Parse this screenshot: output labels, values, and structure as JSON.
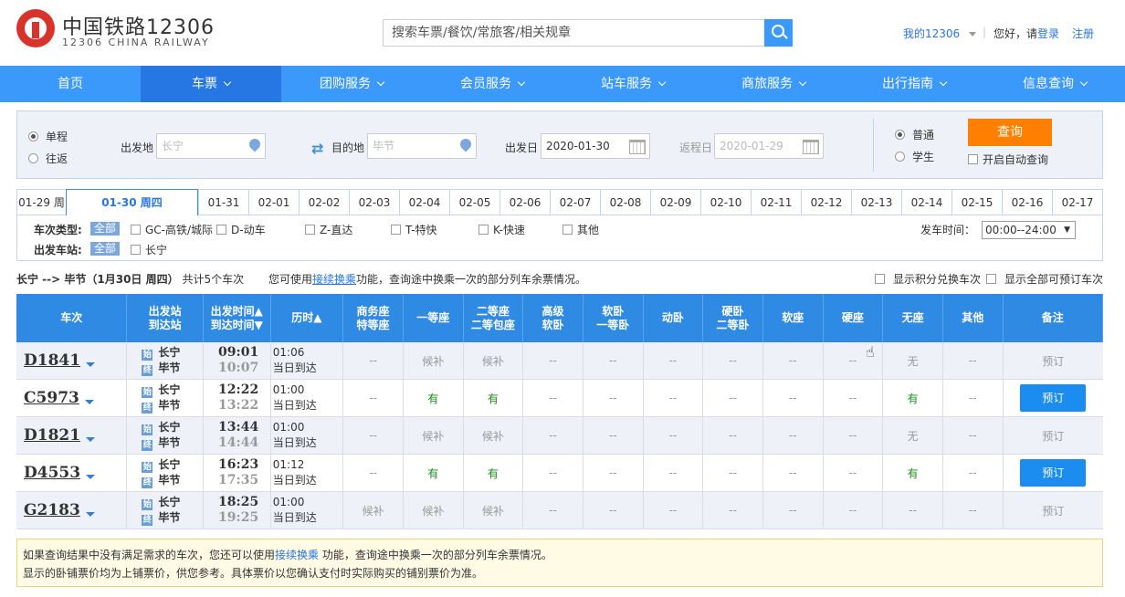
{
  "header": {
    "logo_title": "中国铁路12306",
    "logo_sub": "12306 CHINA RAILWAY",
    "search_placeholder": "搜索车票/餐饮/常旅客/相关规章",
    "my12306": "我的12306",
    "greet": "您好，请",
    "login": "登录",
    "register": "注册"
  },
  "nav": [
    {
      "label": "首页"
    },
    {
      "label": "车票"
    },
    {
      "label": "团购服务"
    },
    {
      "label": "会员服务"
    },
    {
      "label": "站车服务"
    },
    {
      "label": "商旅服务"
    },
    {
      "label": "出行指南"
    },
    {
      "label": "信息查询"
    }
  ],
  "query": {
    "oneway": "单程",
    "roundtrip": "往返",
    "from_label": "出发地",
    "from_value": "长宁",
    "to_label": "目的地",
    "to_value": "毕节",
    "date_label": "出发日",
    "date_value": "2020-01-30",
    "return_label": "返程日",
    "return_value": "2020-01-29",
    "normal": "普通",
    "student": "学生",
    "query_btn": "查询",
    "auto_query": "开启自动查询"
  },
  "dates": [
    "01-29 周",
    "01-30 周四",
    "01-31",
    "02-01",
    "02-02",
    "02-03",
    "02-04",
    "02-05",
    "02-06",
    "02-07",
    "02-08",
    "02-09",
    "02-10",
    "02-11",
    "02-12",
    "02-13",
    "02-14",
    "02-15",
    "02-16",
    "02-17"
  ],
  "filters": {
    "type_label": "车次类型:",
    "all": "全部",
    "types": [
      "GC-高铁/城际",
      "D-动车",
      "Z-直达",
      "T-特快",
      "K-快速",
      "其他"
    ],
    "station_label": "出发车站:",
    "station": "长宁",
    "time_label": "发车时间：",
    "time_value": "00:00--24:00"
  },
  "summary": {
    "route": "长宁 --> 毕节（1月30日 周四）",
    "count": "共计5个车次",
    "tip_pre": "您可使用",
    "tip_link": "接续换乘",
    "tip_post": "功能，查询途中换乘一次的部分列车余票情况。",
    "opt1": "显示积分兑换车次",
    "opt2": "显示全部可预订车次"
  },
  "table_headers": [
    [
      "车次",
      ""
    ],
    [
      "出发站",
      "到达站"
    ],
    [
      "出发时间▲",
      "到达时间▼"
    ],
    [
      "历时▲",
      ""
    ],
    [
      "商务座",
      "特等座"
    ],
    [
      "一等座",
      ""
    ],
    [
      "二等座",
      "二等包座"
    ],
    [
      "高级",
      "软卧"
    ],
    [
      "软卧",
      "一等卧"
    ],
    [
      "动卧",
      ""
    ],
    [
      "硬卧",
      "二等卧"
    ],
    [
      "软座",
      ""
    ],
    [
      "硬座",
      ""
    ],
    [
      "无座",
      ""
    ],
    [
      "其他",
      ""
    ],
    [
      "备注",
      ""
    ]
  ],
  "trains": [
    {
      "no": "D1841",
      "from": "长宁",
      "to": "毕节",
      "dep": "09:01",
      "arr": "10:07",
      "dur": "01:06",
      "arrday": "当日到达",
      "seats": [
        "--",
        "候补",
        "候补",
        "--",
        "--",
        "--",
        "--",
        "--",
        "--",
        "无",
        "--"
      ],
      "action": "预订",
      "bookable": false
    },
    {
      "no": "C5973",
      "from": "长宁",
      "to": "毕节",
      "dep": "12:22",
      "arr": "13:22",
      "dur": "01:00",
      "arrday": "当日到达",
      "seats": [
        "--",
        "有",
        "有",
        "--",
        "--",
        "--",
        "--",
        "--",
        "--",
        "有",
        "--"
      ],
      "action": "预订",
      "bookable": true
    },
    {
      "no": "D1821",
      "from": "长宁",
      "to": "毕节",
      "dep": "13:44",
      "arr": "14:44",
      "dur": "01:00",
      "arrday": "当日到达",
      "seats": [
        "--",
        "候补",
        "候补",
        "--",
        "--",
        "--",
        "--",
        "--",
        "--",
        "无",
        "--"
      ],
      "action": "预订",
      "bookable": false
    },
    {
      "no": "D4553",
      "from": "长宁",
      "to": "毕节",
      "dep": "16:23",
      "arr": "17:35",
      "dur": "01:12",
      "arrday": "当日到达",
      "seats": [
        "--",
        "有",
        "有",
        "--",
        "--",
        "--",
        "--",
        "--",
        "--",
        "有",
        "--"
      ],
      "action": "预订",
      "bookable": true
    },
    {
      "no": "G2183",
      "from": "长宁",
      "to": "毕节",
      "dep": "18:25",
      "arr": "19:25",
      "dur": "01:00",
      "arrday": "当日到达",
      "seats": [
        "候补",
        "候补",
        "候补",
        "--",
        "--",
        "--",
        "--",
        "--",
        "--",
        "--",
        "--"
      ],
      "action": "预订",
      "bookable": false
    }
  ],
  "note": {
    "l1_pre": "如果查询结果中没有满足需求的车次，您还可以使用",
    "l1_link": "接续换乘",
    "l1_post": " 功能，查询途中换乘一次的部分列车余票情况。",
    "l2": "显示的卧铺票价均为上铺票价，供您参考。具体票价以您确认支付时实际购买的铺别票价为准。"
  },
  "colors": {
    "nav": "#3b99fc",
    "nav_active": "#2676e3",
    "thead": "#2f8ae3",
    "query_btn": "#ff8000",
    "book_btn": "#1b8cf0",
    "avail": "#198b19"
  }
}
